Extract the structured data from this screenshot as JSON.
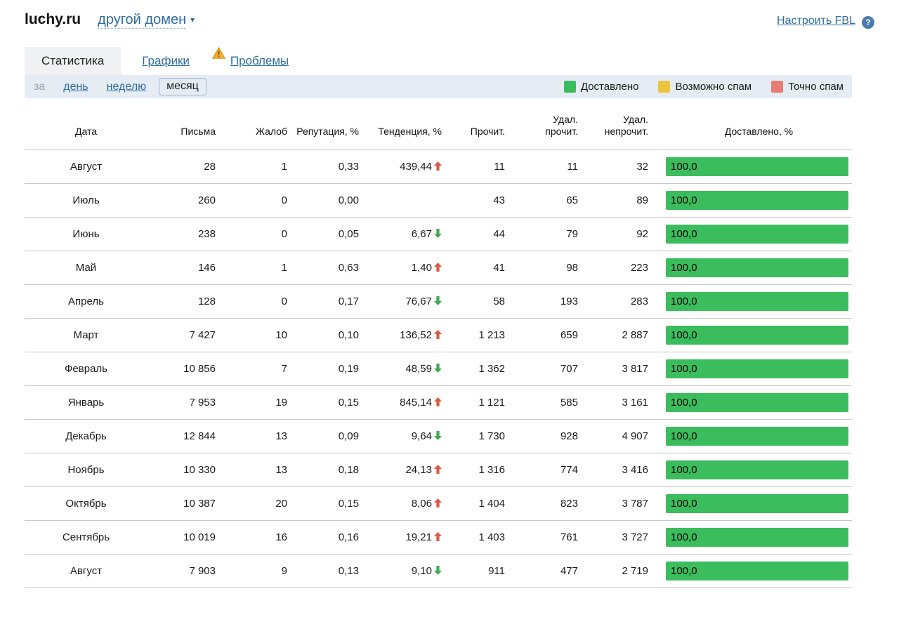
{
  "header": {
    "domain": "luchy.ru",
    "other_domain_label": "другой домен",
    "fbl_link_label": "Настроить FBL",
    "help_icon": "?"
  },
  "tabs": [
    {
      "label": "Статистика",
      "active": true
    },
    {
      "label": "Графики",
      "active": false
    },
    {
      "label": "Проблемы",
      "active": false,
      "warning": true
    }
  ],
  "period_filter": {
    "prefix": "за",
    "options": [
      {
        "label": "день",
        "selected": false
      },
      {
        "label": "неделю",
        "selected": false
      },
      {
        "label": "месяц",
        "selected": true
      }
    ]
  },
  "legend": [
    {
      "label": "Доставлено",
      "color": "#3bbd5e"
    },
    {
      "label": "Возможно спам",
      "color": "#eac43e"
    },
    {
      "label": "Точно спам",
      "color": "#e97c72"
    }
  ],
  "colors": {
    "delivered_bar": "#3bbd5e",
    "trend_up": "#e0593c",
    "trend_down": "#3cab52"
  },
  "table": {
    "columns": [
      "Дата",
      "Письма",
      "Жалоб",
      "Репутация, %",
      "Тенденция, %",
      "Прочит.",
      "Удал.\nпрочит.",
      "Удал.\nнепрочит.",
      "Доставлено, %"
    ],
    "rows": [
      {
        "date": "Август",
        "letters": "28",
        "complaints": "1",
        "reputation": "0,33",
        "trend": "439,44",
        "trend_dir": "up",
        "read": "11",
        "deleted_read": "11",
        "deleted_unread": "32",
        "delivered": "100,0"
      },
      {
        "date": "Июль",
        "letters": "260",
        "complaints": "0",
        "reputation": "0,00",
        "trend": "",
        "trend_dir": "",
        "read": "43",
        "deleted_read": "65",
        "deleted_unread": "89",
        "delivered": "100,0"
      },
      {
        "date": "Июнь",
        "letters": "238",
        "complaints": "0",
        "reputation": "0,05",
        "trend": "6,67",
        "trend_dir": "down",
        "read": "44",
        "deleted_read": "79",
        "deleted_unread": "92",
        "delivered": "100,0"
      },
      {
        "date": "Май",
        "letters": "146",
        "complaints": "1",
        "reputation": "0,63",
        "trend": "1,40",
        "trend_dir": "up",
        "read": "41",
        "deleted_read": "98",
        "deleted_unread": "223",
        "delivered": "100,0"
      },
      {
        "date": "Апрель",
        "letters": "128",
        "complaints": "0",
        "reputation": "0,17",
        "trend": "76,67",
        "trend_dir": "down",
        "read": "58",
        "deleted_read": "193",
        "deleted_unread": "283",
        "delivered": "100,0"
      },
      {
        "date": "Март",
        "letters": "7 427",
        "complaints": "10",
        "reputation": "0,10",
        "trend": "136,52",
        "trend_dir": "up",
        "read": "1 213",
        "deleted_read": "659",
        "deleted_unread": "2 887",
        "delivered": "100,0"
      },
      {
        "date": "Февраль",
        "letters": "10 856",
        "complaints": "7",
        "reputation": "0,19",
        "trend": "48,59",
        "trend_dir": "down",
        "read": "1 362",
        "deleted_read": "707",
        "deleted_unread": "3 817",
        "delivered": "100,0"
      },
      {
        "date": "Январь",
        "letters": "7 953",
        "complaints": "19",
        "reputation": "0,15",
        "trend": "845,14",
        "trend_dir": "up",
        "read": "1 121",
        "deleted_read": "585",
        "deleted_unread": "3 161",
        "delivered": "100,0"
      },
      {
        "date": "Декабрь",
        "letters": "12 844",
        "complaints": "13",
        "reputation": "0,09",
        "trend": "9,64",
        "trend_dir": "down",
        "read": "1 730",
        "deleted_read": "928",
        "deleted_unread": "4 907",
        "delivered": "100,0"
      },
      {
        "date": "Ноябрь",
        "letters": "10 330",
        "complaints": "13",
        "reputation": "0,18",
        "trend": "24,13",
        "trend_dir": "up",
        "read": "1 316",
        "deleted_read": "774",
        "deleted_unread": "3 416",
        "delivered": "100,0"
      },
      {
        "date": "Октябрь",
        "letters": "10 387",
        "complaints": "20",
        "reputation": "0,15",
        "trend": "8,06",
        "trend_dir": "up",
        "read": "1 404",
        "deleted_read": "823",
        "deleted_unread": "3 787",
        "delivered": "100,0"
      },
      {
        "date": "Сентябрь",
        "letters": "10 019",
        "complaints": "16",
        "reputation": "0,16",
        "trend": "19,21",
        "trend_dir": "up",
        "read": "1 403",
        "deleted_read": "761",
        "deleted_unread": "3 727",
        "delivered": "100,0"
      },
      {
        "date": "Август",
        "letters": "7 903",
        "complaints": "9",
        "reputation": "0,13",
        "trend": "9,10",
        "trend_dir": "down",
        "read": "911",
        "deleted_read": "477",
        "deleted_unread": "2 719",
        "delivered": "100,0"
      }
    ]
  }
}
